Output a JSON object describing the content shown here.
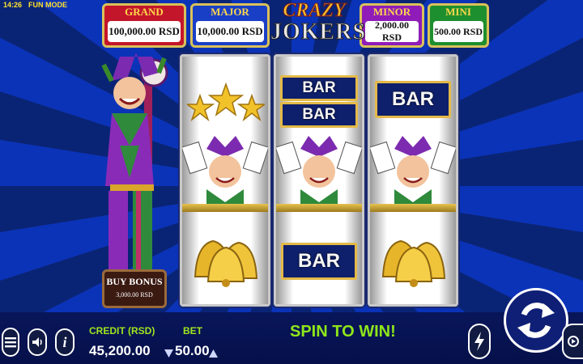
{
  "status": {
    "time": "14:26",
    "mode": "FUN MODE"
  },
  "jackpots": [
    {
      "label": "GRAND",
      "value": "100,000.00 RSD",
      "color": "#c4162a"
    },
    {
      "label": "MAJOR",
      "value": "10,000.00 RSD",
      "color": "#1a3fc7"
    },
    {
      "label": "MINOR",
      "value": "2,000.00 RSD",
      "color": "#8f1cb8"
    },
    {
      "label": "MINI",
      "value": "500.00 RSD",
      "color": "#1e8f2e"
    }
  ],
  "logo": {
    "line1": "CRAZY",
    "line2": "JOKERS"
  },
  "reels": {
    "bar_label": "BAR"
  },
  "buy_bonus": {
    "title": "BUY BONUS",
    "price": "3,000.00 RSD"
  },
  "footer": {
    "credit_label": "CREDIT (RSD)",
    "credit_value": "45,200.00",
    "bet_label": "BET",
    "bet_value": "50.00",
    "spin_message": "SPIN TO WIN!"
  },
  "icons": [
    "menu-icon",
    "sound-icon",
    "info-icon",
    "turbo-icon",
    "spin-icon",
    "autoplay-icon",
    "bet-decrease-icon",
    "bet-increase-icon"
  ]
}
